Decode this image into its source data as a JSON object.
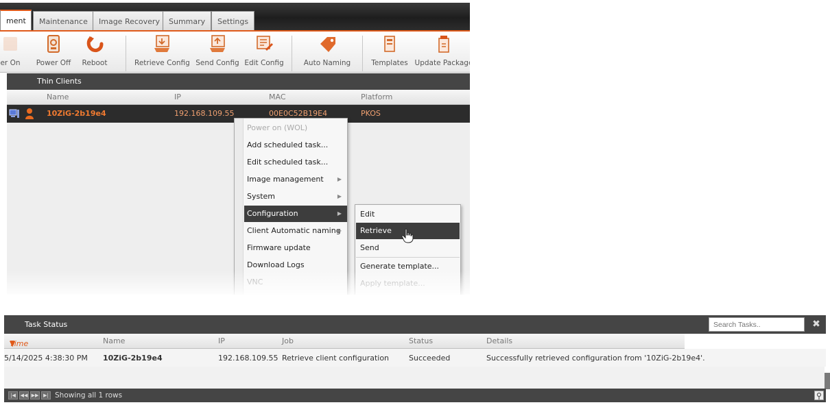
{
  "tabs": [
    {
      "label": "ment",
      "active": true
    },
    {
      "label": "Maintenance",
      "active": false
    },
    {
      "label": "Image Recovery",
      "active": false
    },
    {
      "label": "Summary",
      "active": false
    },
    {
      "label": "Settings",
      "active": false
    }
  ],
  "ribbon": {
    "power_on": "er On",
    "power_off": "Power Off",
    "reboot": "Reboot",
    "retrieve_config": "Retrieve Config",
    "send_config": "Send Config",
    "edit_config": "Edit Config",
    "auto_naming": "Auto Naming",
    "templates": "Templates",
    "update_package": "Update Package"
  },
  "thin_clients": {
    "title": "Thin Clients",
    "columns": {
      "name": "Name",
      "ip": "IP",
      "mac": "MAC",
      "platform": "Platform"
    },
    "row": {
      "name": "10ZiG-2b19e4",
      "ip": "192.168.109.55",
      "mac": "00E0C52B19E4",
      "platform": "PKOS"
    }
  },
  "context_menu": {
    "items": [
      {
        "label": "Power on (WOL)",
        "disabled": true,
        "submenu": false
      },
      {
        "label": "Add scheduled task...",
        "disabled": false,
        "submenu": false
      },
      {
        "label": "Edit scheduled task...",
        "disabled": false,
        "submenu": false
      },
      {
        "label": "Image management",
        "disabled": false,
        "submenu": true
      },
      {
        "label": "System",
        "disabled": false,
        "submenu": true
      },
      {
        "label": "Configuration",
        "disabled": false,
        "submenu": true,
        "highlighted": true
      },
      {
        "label": "Client Automatic naming",
        "disabled": false,
        "submenu": true
      },
      {
        "label": "Firmware update",
        "disabled": false,
        "submenu": false
      },
      {
        "label": "Download Logs",
        "disabled": false,
        "submenu": false
      },
      {
        "label": "VNC",
        "disabled": true,
        "submenu": false
      }
    ],
    "submenu": [
      {
        "label": "Edit"
      },
      {
        "label": "Retrieve",
        "highlighted": true
      },
      {
        "label": "Send"
      },
      {
        "label": "Generate template..."
      },
      {
        "label": "Apply template...",
        "disabled": true
      }
    ]
  },
  "task_status": {
    "title": "Task Status",
    "search_placeholder": "Search Tasks..",
    "columns": {
      "time": "Time",
      "name": "Name",
      "ip": "IP",
      "job": "Job",
      "status": "Status",
      "details": "Details"
    },
    "rows": [
      {
        "time": "5/14/2025 4:38:30 PM",
        "name": "10ZiG-2b19e4",
        "ip": "192.168.109.55",
        "job": "Retrieve client configuration",
        "status": "Succeeded",
        "details": "Successfully retrieved configuration from '10ZiG-2b19e4'."
      }
    ],
    "footer": "Showing all 1 rows"
  },
  "colors": {
    "accent": "#e05a1a",
    "dark": "#454545",
    "highlight": "#3d3d3d"
  }
}
